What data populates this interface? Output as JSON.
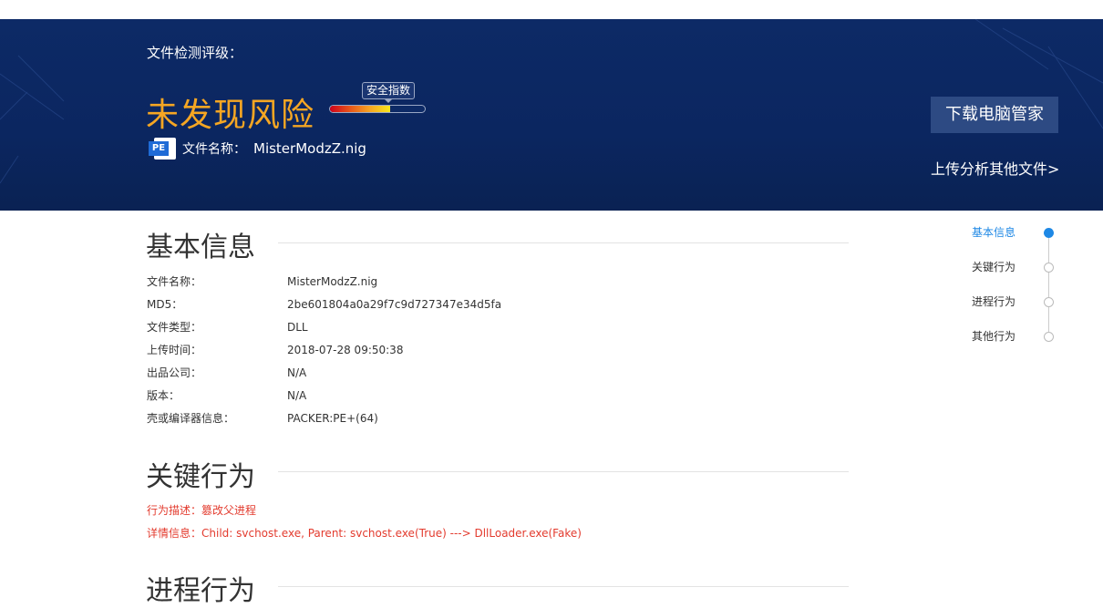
{
  "banner": {
    "rating_label": "文件检测评级：",
    "verdict": "未发现风险",
    "safety_index_label": "安全指数",
    "safety_index_fill": 0.63,
    "file_icon_label": "PE",
    "file_name_label": "文件名称：",
    "file_name": "MisterModzZ.nig",
    "download_button": "下载电脑管家",
    "upload_link": "上传分析其他文件>"
  },
  "basic_info": {
    "title": "基本信息",
    "rows": [
      {
        "key": "文件名称：",
        "value": "MisterModzZ.nig"
      },
      {
        "key": "MD5：",
        "value": "2be601804a0a29f7c9d727347e34d5fa"
      },
      {
        "key": "文件类型：",
        "value": "DLL"
      },
      {
        "key": "上传时间：",
        "value": "2018-07-28 09:50:38"
      },
      {
        "key": "出品公司：",
        "value": "N/A"
      },
      {
        "key": "版本：",
        "value": "N/A"
      },
      {
        "key": "壳或编译器信息：",
        "value": "PACKER:PE+(64)"
      }
    ]
  },
  "key_behavior": {
    "title": "关键行为",
    "description": "行为描述：篡改父进程",
    "details": "详情信息：Child: svchost.exe, Parent: svchost.exe(True) ---> DllLoader.exe(Fake)"
  },
  "process_behavior": {
    "title": "进程行为"
  },
  "side_nav": {
    "items": [
      "基本信息",
      "关键行为",
      "进程行为",
      "其他行为"
    ],
    "active_index": 0
  },
  "colors": {
    "banner": "#0d2a66",
    "verdict": "#f5a623",
    "accent": "#1e88e5",
    "alert": "#e33b2e"
  }
}
